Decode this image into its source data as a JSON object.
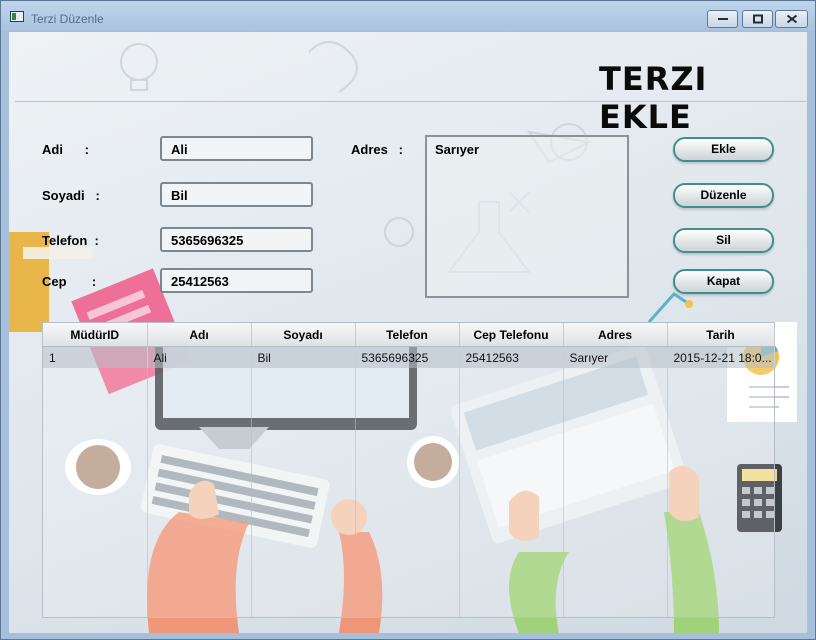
{
  "window": {
    "title": "Terzi Düzenle",
    "controls": {
      "minimize": "minimize-icon",
      "maximize": "maximize-icon",
      "close": "close-icon"
    }
  },
  "header": {
    "title": "TERZI EKLE"
  },
  "form": {
    "labels": {
      "adi": "Adi      :",
      "soyadi": "Soyadi   :",
      "telefon": "Telefon  :",
      "cep": "Cep       :",
      "adres": "Adres   :"
    },
    "values": {
      "adi": "Ali",
      "soyadi": "Bil",
      "telefon": "5365696325",
      "cep": "25412563",
      "adres": "Sarıyer"
    }
  },
  "buttons": {
    "ekle": "Ekle",
    "duzenle": "Düzenle",
    "sil": "Sil",
    "kapat": "Kapat"
  },
  "grid": {
    "columns": [
      "MüdürID",
      "Adı",
      "Soyadı",
      "Telefon",
      "Cep Telefonu",
      "Adres",
      "Tarih"
    ],
    "rows": [
      [
        "1",
        "Ali",
        "Bil",
        "5365696325",
        "25412563",
        "Sarıyer",
        "2015-12-21 18:0..."
      ]
    ]
  },
  "colors": {
    "accent": "#3f8f8d",
    "titlebar": "#a9c3de",
    "background": "#e4eaef"
  }
}
